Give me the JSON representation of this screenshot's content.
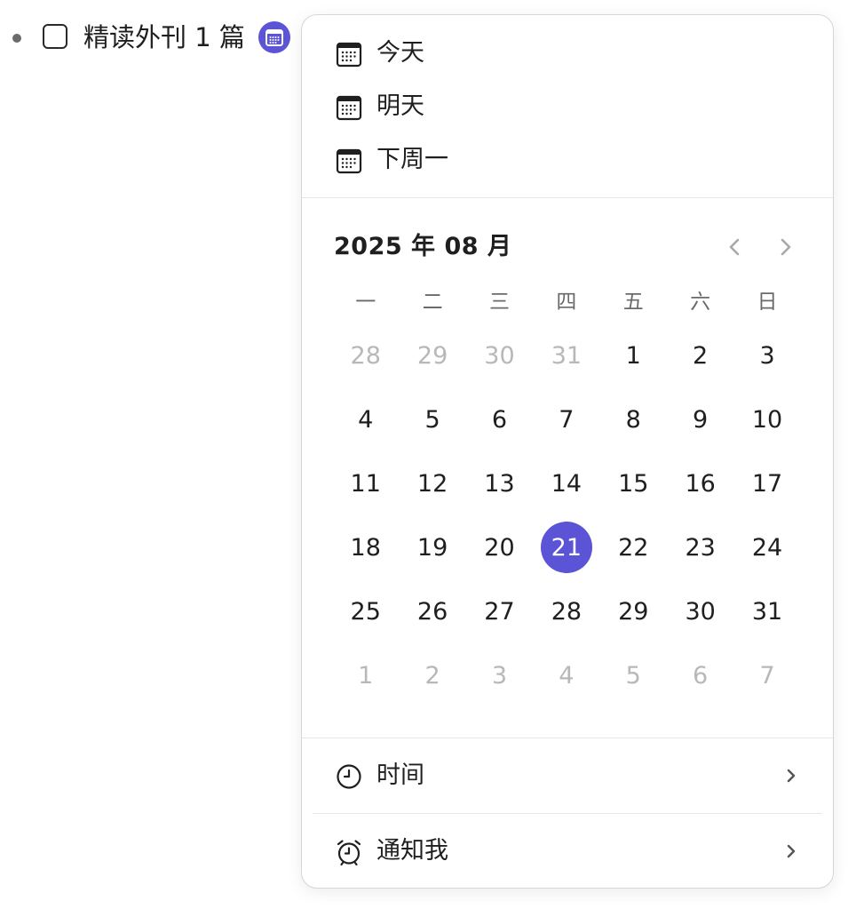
{
  "task": {
    "text": "精读外刊 1 篇"
  },
  "quick_options": [
    {
      "label": "今天",
      "icon": "calendar-icon"
    },
    {
      "label": "明天",
      "icon": "calendar-icon"
    },
    {
      "label": "下周一",
      "icon": "calendar-icon"
    }
  ],
  "calendar": {
    "month_title": "2025 年 08 月",
    "weekdays": [
      "一",
      "二",
      "三",
      "四",
      "五",
      "六",
      "日"
    ],
    "days": [
      {
        "d": "28",
        "m": true
      },
      {
        "d": "29",
        "m": true
      },
      {
        "d": "30",
        "m": true
      },
      {
        "d": "31",
        "m": true
      },
      {
        "d": "1"
      },
      {
        "d": "2"
      },
      {
        "d": "3"
      },
      {
        "d": "4"
      },
      {
        "d": "5"
      },
      {
        "d": "6"
      },
      {
        "d": "7"
      },
      {
        "d": "8"
      },
      {
        "d": "9"
      },
      {
        "d": "10"
      },
      {
        "d": "11"
      },
      {
        "d": "12"
      },
      {
        "d": "13"
      },
      {
        "d": "14"
      },
      {
        "d": "15"
      },
      {
        "d": "16"
      },
      {
        "d": "17"
      },
      {
        "d": "18"
      },
      {
        "d": "19"
      },
      {
        "d": "20"
      },
      {
        "d": "21",
        "s": true
      },
      {
        "d": "22"
      },
      {
        "d": "23"
      },
      {
        "d": "24"
      },
      {
        "d": "25"
      },
      {
        "d": "26"
      },
      {
        "d": "27"
      },
      {
        "d": "28"
      },
      {
        "d": "29"
      },
      {
        "d": "30"
      },
      {
        "d": "31"
      },
      {
        "d": "1",
        "m": true
      },
      {
        "d": "2",
        "m": true
      },
      {
        "d": "3",
        "m": true
      },
      {
        "d": "4",
        "m": true
      },
      {
        "d": "5",
        "m": true
      },
      {
        "d": "6",
        "m": true
      },
      {
        "d": "7",
        "m": true
      }
    ],
    "selected_day": "21"
  },
  "time_row": {
    "label": "时间",
    "icon": "clock-icon"
  },
  "notify_row": {
    "label": "通知我",
    "icon": "alarm-clock-icon"
  },
  "colors": {
    "accent": "#5b54d6",
    "muted_day": "#b8b8b8",
    "text": "#1f1f1f"
  }
}
